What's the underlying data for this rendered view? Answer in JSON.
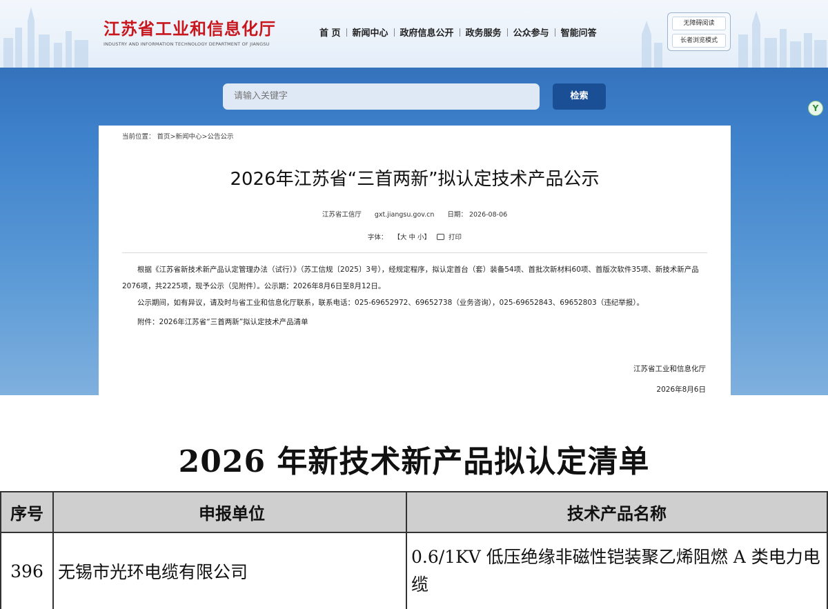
{
  "site": {
    "brand_cn": "江苏省工业和信息化厅",
    "brand_en": "INDUSTRY AND INFORMATION TECHNOLOGY DEPARTMENT OF JIANGSU",
    "nav": [
      "首 页",
      "新闻中心",
      "政府信息公开",
      "政务服务",
      "公众参与",
      "智能问答"
    ],
    "access": [
      "无障碍阅读",
      "长者浏览模式"
    ],
    "search_placeholder": "请输入关键字",
    "search_button": "检索",
    "side_badge": "Y",
    "colors": {
      "brand_red": "#c8161d",
      "search_btn": "#1a4f96",
      "banner": "#3f82cc"
    }
  },
  "article": {
    "breadcrumb": "当前位置： 首页>新闻中心>公告公示",
    "title": "2026年江苏省“三首两新”拟认定技术产品公示",
    "source": "江苏省工信厅",
    "site_url": "gxt.jiangsu.gov.cn",
    "date": "日期： 2026-08-06",
    "font_label": "字体：",
    "font_sizes": "【大 中 小】",
    "print_label": "打印",
    "paragraphs": [
      "根据《江苏省新技术新产品认定管理办法（试行）》（苏工信规〔2025〕3号），经规定程序，拟认定首台（套）装备54项、首批次新材料60项、首版次软件35项、新技术新产品2076项，共2225项，现予公示（见附件）。公示期：2026年8月6日至8月12日。",
      "公示期间，如有异议，请及时与省工业和信息化厅联系，联系电话：025-69652972、69652738（业务咨询），025-69652843、69652803（违纪举报）。",
      "附件：2026年江苏省“三首两新”拟认定技术产品清单"
    ],
    "signature_org": "江苏省工业和信息化厅",
    "signature_date": "2026年8月6日"
  },
  "doc": {
    "title": "2026 年新技术新产品拟认定清单",
    "columns": [
      "序号",
      "申报单位",
      "技术产品名称"
    ],
    "rows": [
      {
        "no": "396",
        "unit": "无锡市光环电缆有限公司",
        "product": "0.6/1KV 低压绝缘非磁性铠装聚乙烯阻燃 A 类电力电缆"
      }
    ]
  }
}
